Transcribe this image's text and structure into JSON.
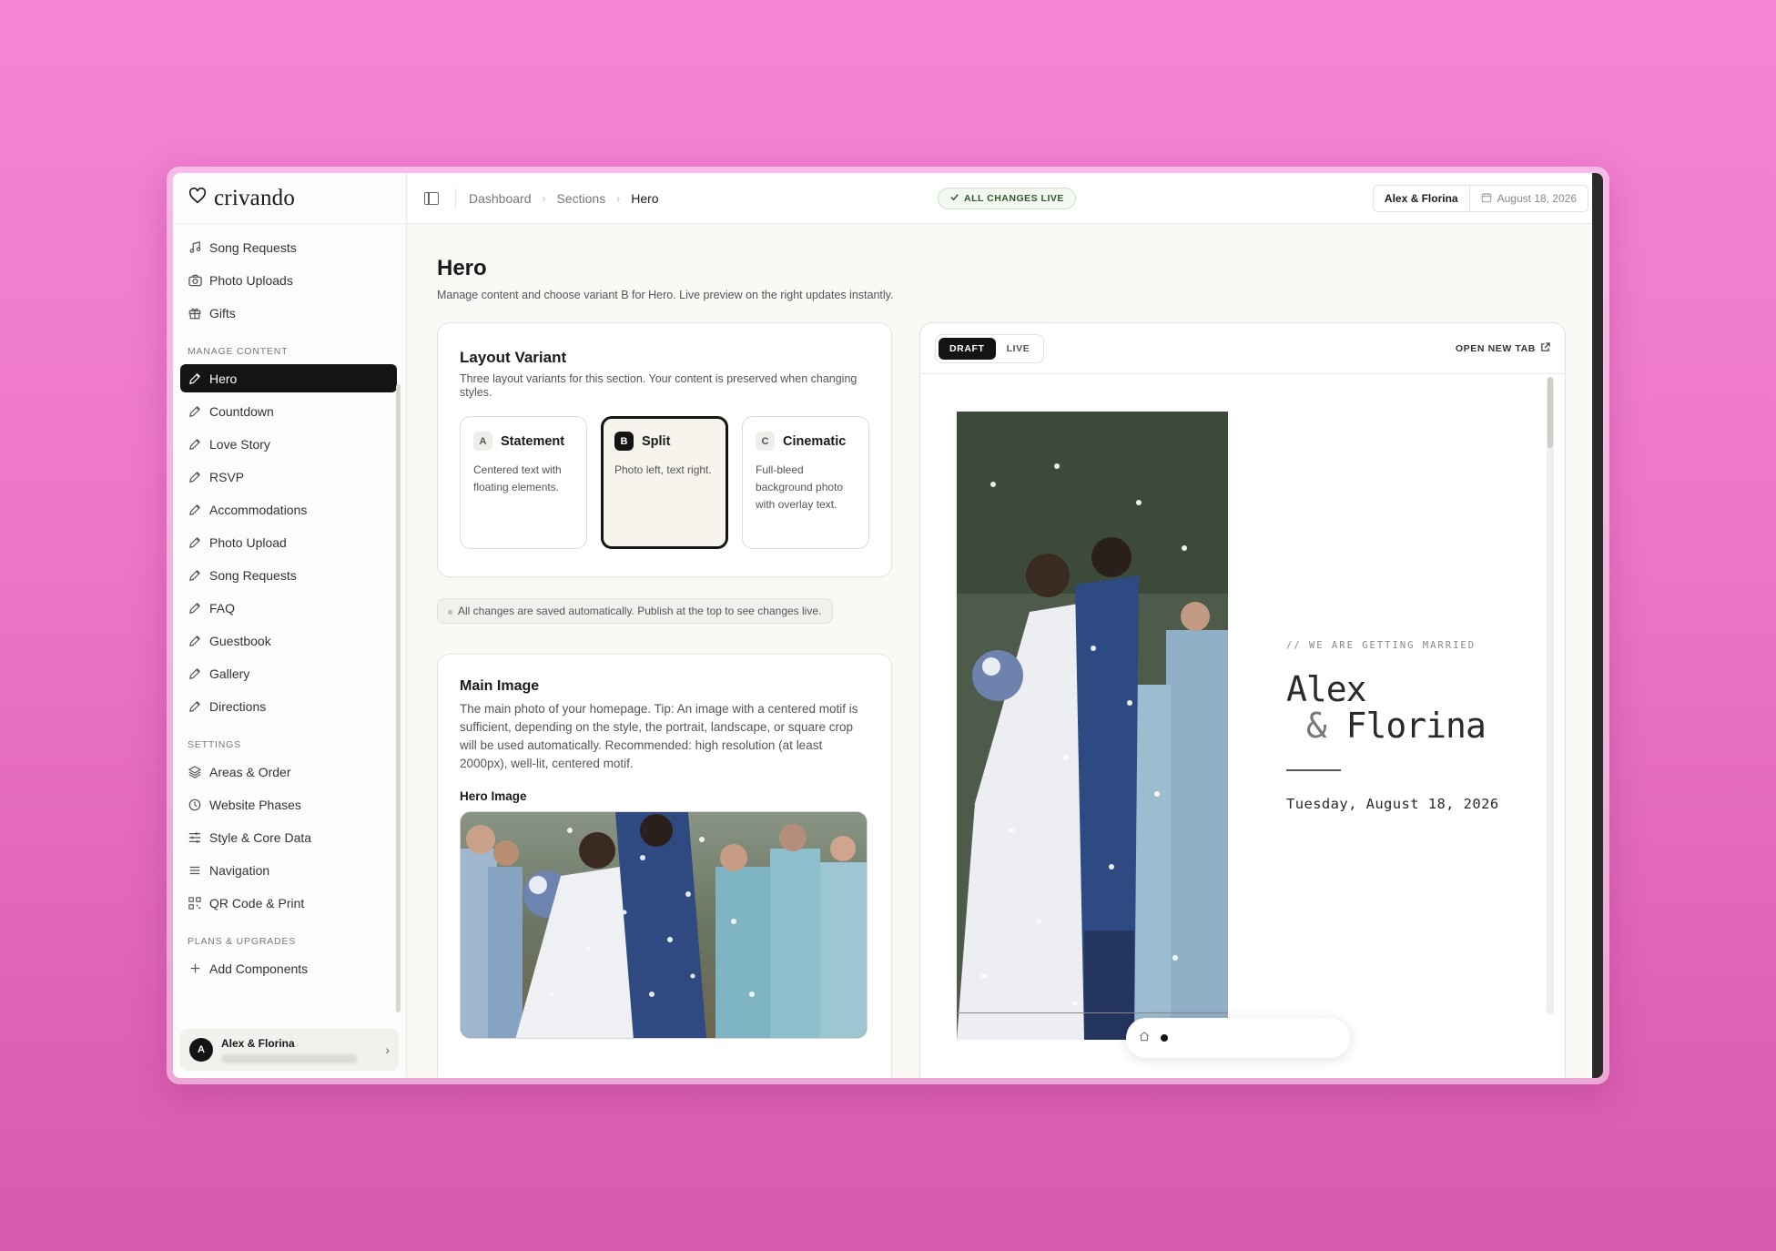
{
  "app": {
    "logo_text": "crivando"
  },
  "sidebar": {
    "top_items": [
      {
        "label": "Song Requests",
        "icon": "music-icon"
      },
      {
        "label": "Photo Uploads",
        "icon": "camera-icon"
      },
      {
        "label": "Gifts",
        "icon": "gift-icon"
      }
    ],
    "manage_heading": "MANAGE CONTENT",
    "manage_items": [
      {
        "label": "Hero",
        "active": true
      },
      {
        "label": "Countdown"
      },
      {
        "label": "Love Story"
      },
      {
        "label": "RSVP"
      },
      {
        "label": "Accommodations"
      },
      {
        "label": "Photo Upload"
      },
      {
        "label": "Song Requests"
      },
      {
        "label": "FAQ"
      },
      {
        "label": "Guestbook"
      },
      {
        "label": "Gallery"
      },
      {
        "label": "Directions"
      }
    ],
    "settings_heading": "SETTINGS",
    "settings_items": [
      {
        "label": "Areas & Order",
        "icon": "layers-icon"
      },
      {
        "label": "Website Phases",
        "icon": "clock-icon"
      },
      {
        "label": "Style & Core Data",
        "icon": "sliders-icon"
      },
      {
        "label": "Navigation",
        "icon": "menu-icon"
      },
      {
        "label": "QR Code & Print",
        "icon": "qr-code-icon"
      }
    ],
    "plans_heading": "PLANS & UPGRADES",
    "plans_items": [
      {
        "label": "Add Components",
        "icon": "plus-icon"
      }
    ],
    "user": {
      "initial": "A",
      "name": "Alex & Florina"
    }
  },
  "topbar": {
    "breadcrumb": [
      "Dashboard",
      "Sections",
      "Hero"
    ],
    "status": "ALL CHANGES LIVE",
    "couple": "Alex & Florina",
    "date": "August 18, 2026"
  },
  "page": {
    "title": "Hero",
    "subtitle": "Manage content and choose variant B for Hero. Live preview on the right updates instantly."
  },
  "layout_card": {
    "title": "Layout Variant",
    "desc": "Three layout variants for this section. Your content is preserved when changing styles.",
    "variants": [
      {
        "badge": "A",
        "name": "Statement",
        "desc": "Centered text with floating elements.",
        "selected": false
      },
      {
        "badge": "B",
        "name": "Split",
        "desc": "Photo left, text right.",
        "selected": true
      },
      {
        "badge": "C",
        "name": "Cinematic",
        "desc": "Full-bleed background photo with overlay text.",
        "selected": false
      }
    ]
  },
  "autosave_note": "All changes are saved automatically. Publish at the top to see changes live.",
  "main_image_card": {
    "title": "Main Image",
    "desc": "The main photo of your homepage. Tip: An image with a centered motif is sufficient, depending on the style, the portrait, landscape, or square crop will be used automatically. Recommended: high resolution (at least 2000px), well-lit, centered motif.",
    "field_label": "Hero Image"
  },
  "preview": {
    "tabs": [
      "DRAFT",
      "LIVE"
    ],
    "active_tab": "DRAFT",
    "open_new_tab": "OPEN NEW TAB",
    "kicker": "// WE ARE GETTING MARRIED",
    "name_line1": "Alex",
    "name_amp": "&",
    "name_line2": "Florina",
    "date": "Tuesday, August 18, 2026"
  },
  "colors": {
    "background_top": "#f585d6",
    "background_bottom": "#d85aae",
    "active_nav": "#141414",
    "status_green": "#2f5a2b"
  }
}
